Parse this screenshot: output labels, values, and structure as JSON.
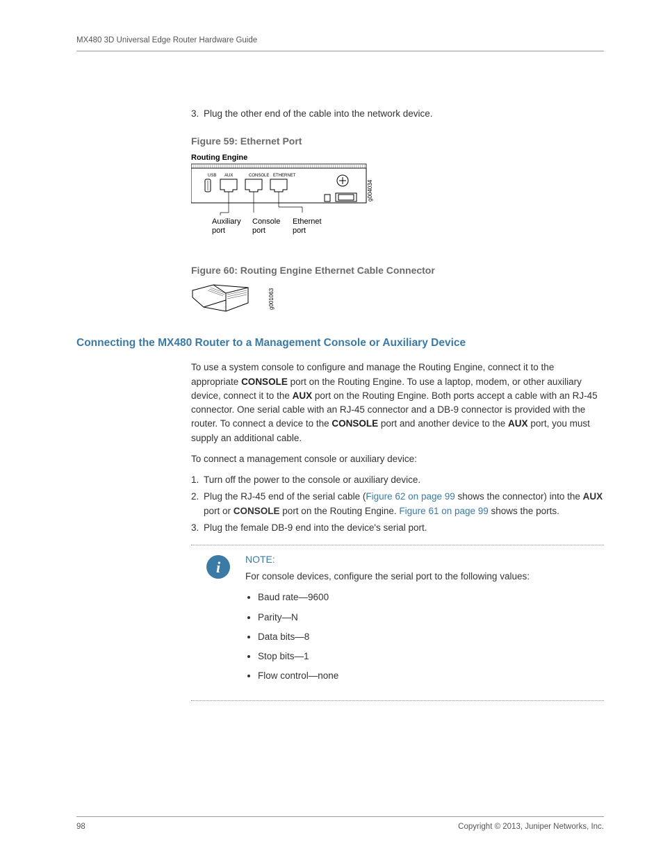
{
  "header": "MX480 3D Universal Edge Router Hardware Guide",
  "step_prefix_1": {
    "num": "3.",
    "text": "Plug the other end of the cable into the network device."
  },
  "figure59": {
    "caption": "Figure 59:  Ethernet Port",
    "panel_title": "Routing Engine",
    "ports_top": {
      "usb": "USB",
      "aux": "AUX",
      "console": "CONSOLE",
      "ethernet": "ETHERNET"
    },
    "sideid": "g004034",
    "callouts": {
      "aux": "Auxiliary\nport",
      "console": "Console\nport",
      "eth": "Ethernet\nport"
    }
  },
  "figure60": {
    "caption": "Figure 60: Routing Engine Ethernet Cable Connector",
    "sideid": "g001063"
  },
  "section_title": "Connecting the MX480 Router to a Management Console or Auxiliary Device",
  "para1a": "To use a system console to configure and manage the Routing Engine, connect it to the appropriate ",
  "para1b": " port on the Routing Engine. To use a laptop, modem, or other auxiliary device, connect it to the ",
  "para1c": " port on the Routing Engine. Both ports accept a cable with an RJ-45 connector. One serial cable with an RJ-45 connector and a DB-9 connector is provided with the router. To connect a device to the ",
  "para1d": " port and another device to the ",
  "para1e": " port, you must supply an additional cable.",
  "strong": {
    "console": "CONSOLE",
    "aux": "AUX"
  },
  "para2": "To connect a management console or auxiliary device:",
  "steps": {
    "s1": {
      "num": "1.",
      "text": "Turn off the power to the console or auxiliary device."
    },
    "s2": {
      "num": "2.",
      "a": "Plug the RJ-45 end of the serial cable (",
      "link1": "Figure 62 on page 99",
      "b": " shows the connector) into the ",
      "c": " port or ",
      "d": " port on the Routing Engine. ",
      "link2": "Figure 61 on page 99",
      "e": " shows the ports."
    },
    "s3": {
      "num": "3.",
      "text": "Plug the female DB-9 end into the device's serial port."
    }
  },
  "note": {
    "title": "NOTE:",
    "lead": "For console devices, configure the serial port to the following values:",
    "items": [
      "Baud rate—9600",
      "Parity—N",
      "Data bits—8",
      "Stop bits—1",
      "Flow control—none"
    ]
  },
  "footer": {
    "page": "98",
    "copyright": "Copyright © 2013, Juniper Networks, Inc."
  }
}
